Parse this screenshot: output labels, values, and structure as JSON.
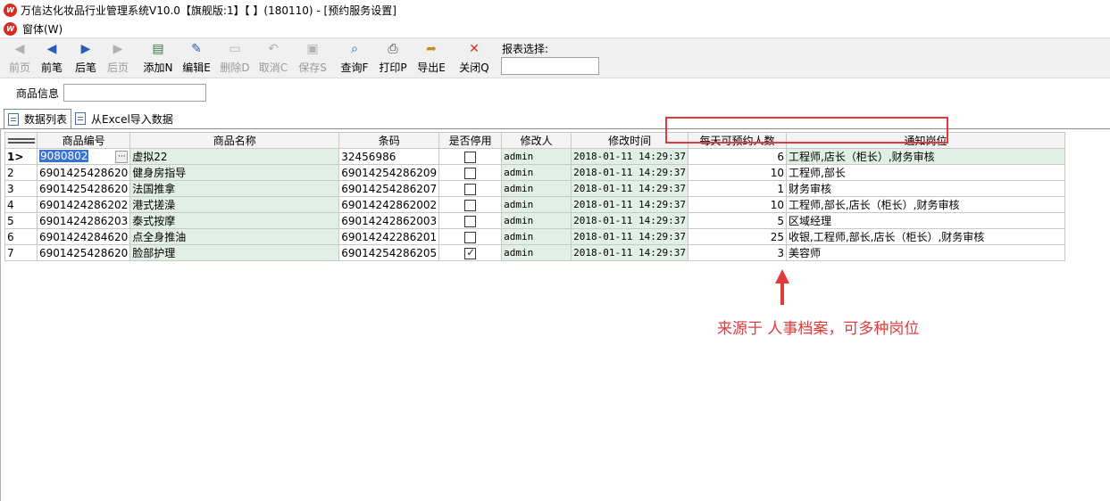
{
  "window": {
    "title": "万信达化妆品行业管理系统V10.0【旗舰版:1】【      】(180110) - [预约服务设置]",
    "menu_label": "窗体(W)"
  },
  "toolbar": {
    "buttons": [
      {
        "label": "前页",
        "icon": "arrow-left-first-icon",
        "enabled": false
      },
      {
        "label": "前笔",
        "icon": "arrow-left-icon",
        "enabled": true
      },
      {
        "label": "后笔",
        "icon": "arrow-right-icon",
        "enabled": true
      },
      {
        "label": "后页",
        "icon": "arrow-right-last-icon",
        "enabled": false
      },
      {
        "label": "添加N",
        "icon": "add-icon",
        "enabled": true
      },
      {
        "label": "编辑E",
        "icon": "edit-icon",
        "enabled": true
      },
      {
        "label": "删除D",
        "icon": "delete-icon",
        "enabled": false
      },
      {
        "label": "取消C",
        "icon": "undo-icon",
        "enabled": false
      },
      {
        "label": "保存S",
        "icon": "save-icon",
        "enabled": false
      },
      {
        "label": "查询F",
        "icon": "search-icon",
        "enabled": true
      },
      {
        "label": "打印P",
        "icon": "print-icon",
        "enabled": true
      },
      {
        "label": "导出E",
        "icon": "export-icon",
        "enabled": true
      },
      {
        "label": "关闭Q",
        "icon": "close-icon",
        "enabled": true
      }
    ],
    "report_label": "报表选择:",
    "report_value": ""
  },
  "filter": {
    "label": "商品信息",
    "value": ""
  },
  "tabs": [
    {
      "label": "数据列表",
      "active": true
    },
    {
      "label": "从Excel导入数据",
      "active": false
    }
  ],
  "grid": {
    "columns": [
      "商品编号",
      "商品名称",
      "条码",
      "是否停用",
      "修改人",
      "修改时间",
      "每天可预约人数",
      "通知岗位"
    ],
    "rows": [
      {
        "idx": "1",
        "code": "9080802",
        "name": "虚拟22",
        "barcode": "32456986",
        "disabled": false,
        "modifier": "admin",
        "time": "2018-01-11 14:29:37",
        "quota": "6",
        "post": "工程师,店长（柜长）,财务审核",
        "selected": true
      },
      {
        "idx": "2",
        "code": "6901425428620",
        "name": "健身房指导",
        "barcode": "69014254286209",
        "disabled": false,
        "modifier": "admin",
        "time": "2018-01-11 14:29:37",
        "quota": "10",
        "post": "工程师,部长",
        "selected": false
      },
      {
        "idx": "3",
        "code": "6901425428620",
        "name": "法国推拿",
        "barcode": "69014254286207",
        "disabled": false,
        "modifier": "admin",
        "time": "2018-01-11 14:29:37",
        "quota": "1",
        "post": "财务审核",
        "selected": false
      },
      {
        "idx": "4",
        "code": "6901424286202",
        "name": "港式搓澡",
        "barcode": "69014242862002",
        "disabled": false,
        "modifier": "admin",
        "time": "2018-01-11 14:29:37",
        "quota": "10",
        "post": "工程师,部长,店长（柜长）,财务审核",
        "selected": false
      },
      {
        "idx": "5",
        "code": "6901424286203",
        "name": "泰式按摩",
        "barcode": "69014242862003",
        "disabled": false,
        "modifier": "admin",
        "time": "2018-01-11 14:29:37",
        "quota": "5",
        "post": "区域经理",
        "selected": false
      },
      {
        "idx": "6",
        "code": "6901424284620",
        "name": "点全身推油",
        "barcode": "69014242286201",
        "disabled": false,
        "modifier": "admin",
        "time": "2018-01-11 14:29:37",
        "quota": "25",
        "post": "收银,工程师,部长,店长（柜长）,财务审核",
        "selected": false
      },
      {
        "idx": "7",
        "code": "6901425428620",
        "name": "脸部护理",
        "barcode": "69014254286205",
        "disabled": true,
        "modifier": "admin",
        "time": "2018-01-11 14:29:37",
        "quota": "3",
        "post": "美容师",
        "selected": false
      }
    ]
  },
  "annotation": {
    "text": "来源于 人事档案，可多种岗位",
    "color": "#e23a3a"
  },
  "colors": {
    "row_green": "#e2efe6",
    "selection_blue": "#3b73d1",
    "annotation_red": "#e23a3a",
    "logo_red": "#d62d20"
  }
}
